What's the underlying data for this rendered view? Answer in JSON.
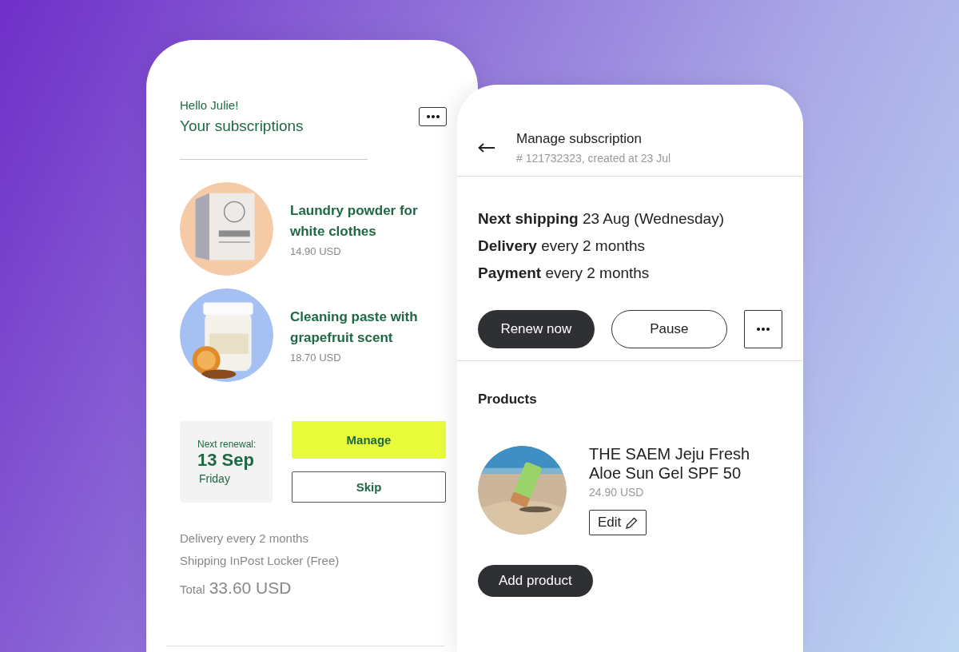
{
  "subscriptions_screen": {
    "greeting": "Hello Julie!",
    "title": "Your subscriptions",
    "items": [
      {
        "name": "Laundry powder for white clothes",
        "price": "14.90 USD"
      },
      {
        "name": "Cleaning paste with grapefruit scent",
        "price": "18.70 USD"
      }
    ],
    "renewal": {
      "label": "Next renewal:",
      "date": "13 Sep",
      "weekday": "Friday"
    },
    "buttons": [
      {
        "label": "Manage",
        "kind": "primary"
      },
      {
        "label": "Skip",
        "kind": "outline"
      }
    ],
    "delivery": "Delivery every 2 months",
    "shipping": "Shipping InPost Locker (Free)",
    "total_label": "Total",
    "total_value": "33.60 USD"
  },
  "manage_screen": {
    "title": "Manage subscription",
    "subtitle": "# 121732323, created at 23 Jul",
    "details": [
      "**Next shipping** 23 Aug (Wednesday)",
      "**Delivery** every 2 months",
      "**Payment** every 2 months"
    ],
    "actions": [
      {
        "label": "Renew now",
        "kind": "primary"
      },
      {
        "label": "Pause",
        "kind": "outline"
      }
    ],
    "products_heading": "Products",
    "products": [
      {
        "name": "THE SAEM Jeju Fresh Aloe Sun Gel SPF 50",
        "price": "24.90 USD",
        "edit_label": "Edit"
      }
    ],
    "add_button": "Add product"
  }
}
